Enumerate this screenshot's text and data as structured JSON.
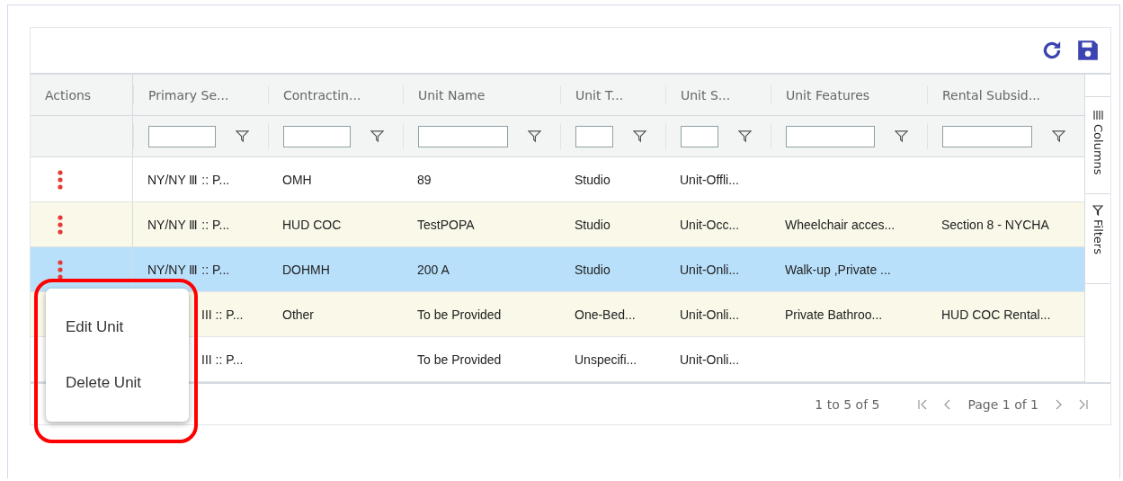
{
  "columns": [
    {
      "label": "Actions",
      "filter": false
    },
    {
      "label": "Primary Se...",
      "filter": true
    },
    {
      "label": "Contractin...",
      "filter": true
    },
    {
      "label": "Unit Name",
      "filter": true
    },
    {
      "label": "Unit T...",
      "filter": true
    },
    {
      "label": "Unit S...",
      "filter": true
    },
    {
      "label": "Unit Features",
      "filter": true
    },
    {
      "label": "Rental Subsid...",
      "filter": true
    }
  ],
  "rows": [
    {
      "selected": false,
      "under_menu": false,
      "cells": [
        "NY/NY Ⅲ :: P...",
        "OMH",
        "89",
        "Studio",
        "Unit-Offli...",
        "",
        ""
      ]
    },
    {
      "selected": false,
      "under_menu": false,
      "cells": [
        "NY/NY Ⅲ :: P...",
        "HUD COC",
        "TestPOPA",
        "Studio",
        "Unit-Occ...",
        "Wheelchair acces...",
        "Section 8 - NYCHA"
      ]
    },
    {
      "selected": true,
      "under_menu": false,
      "cells": [
        "NY/NY Ⅲ :: P...",
        "DOHMH",
        "200 A",
        "Studio",
        "Unit-Onli...",
        "Walk-up ,Private ...",
        ""
      ]
    },
    {
      "selected": false,
      "under_menu": true,
      "cells": [
        "III :: P...",
        "Other",
        "To be Provided",
        "One-Bed...",
        "Unit-Onli...",
        "Private Bathroo...",
        "HUD COC Rental..."
      ]
    },
    {
      "selected": false,
      "under_menu": true,
      "cells": [
        "III :: P...",
        "",
        "To be Provided",
        "Unspecifi...",
        "Unit-Onli...",
        "",
        ""
      ]
    }
  ],
  "side_tabs": [
    "Columns",
    "Filters"
  ],
  "footer": {
    "count": "1 to 5 of 5",
    "page": "Page 1 of 1"
  },
  "menu": {
    "items": [
      "Edit Unit",
      "Delete Unit"
    ],
    "highlighted": true
  }
}
